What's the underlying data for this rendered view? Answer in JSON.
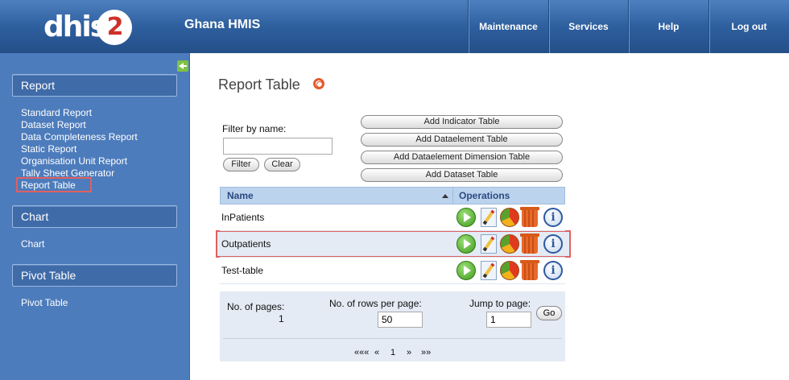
{
  "header": {
    "logo_text": "dhis",
    "logo_number": "2",
    "app_title": "Ghana HMIS",
    "menu": [
      "Maintenance",
      "Services",
      "Help",
      "Log out"
    ]
  },
  "sidebar": {
    "sections": [
      {
        "title": "Report",
        "items": [
          "Standard Report",
          "Dataset Report",
          "Data Completeness Report",
          "Static Report",
          "Organisation Unit Report",
          "Tally Sheet Generator",
          "Report Table"
        ]
      },
      {
        "title": "Chart",
        "items": [
          "Chart"
        ]
      },
      {
        "title": "Pivot Table",
        "items": [
          "Pivot Table"
        ]
      }
    ],
    "active_item": "Report Table"
  },
  "main": {
    "title": "Report Table",
    "filter": {
      "label": "Filter by name:",
      "value": "",
      "filter_button": "Filter",
      "clear_button": "Clear"
    },
    "add_buttons": [
      "Add Indicator Table",
      "Add Dataelement Table",
      "Add Dataelement Dimension Table",
      "Add Dataset Table"
    ],
    "table": {
      "columns": [
        "Name",
        "Operations"
      ],
      "rows": [
        "InPatients",
        "Outpatients",
        "Test-table"
      ],
      "highlighted_row": "Outpatients",
      "operation_icons": [
        "run-icon",
        "edit-icon",
        "chart-icon",
        "delete-icon",
        "info-icon"
      ]
    },
    "pager": {
      "pages_label": "No. of pages:",
      "pages_value": "1",
      "rows_label": "No. of rows per page:",
      "rows_value": "50",
      "jump_label": "Jump to page:",
      "jump_value": "1",
      "go_button": "Go",
      "nav": {
        "first": "«««",
        "prev": "«",
        "current": "1",
        "next": "»",
        "last": "»»"
      }
    }
  },
  "colors": {
    "header": "#2e5f9e",
    "sidebar": "#4d7cbc",
    "table_header": "#bcd3ee",
    "highlight": "#e06060"
  }
}
